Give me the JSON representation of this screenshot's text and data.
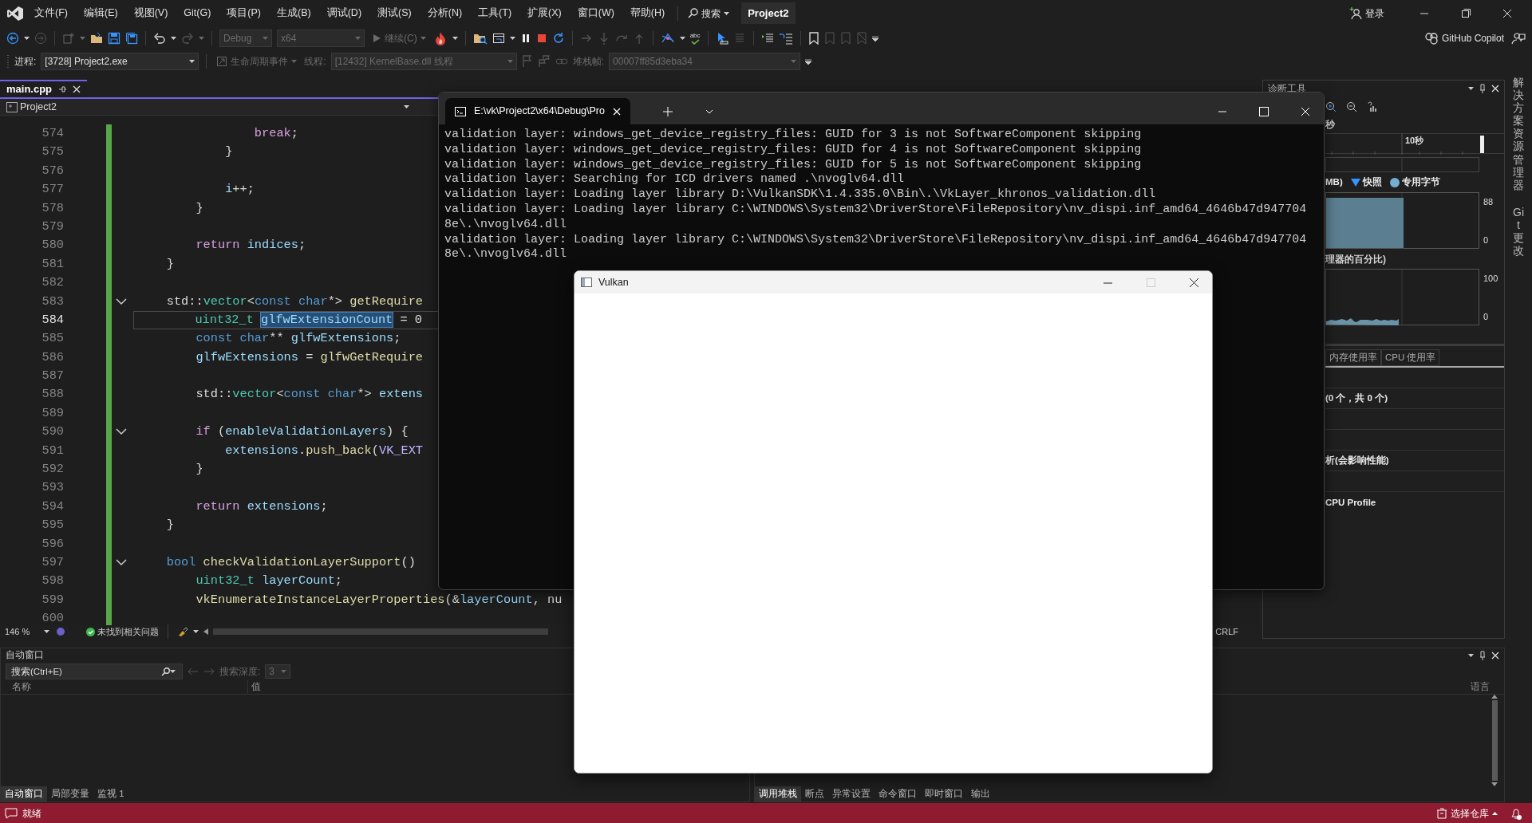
{
  "menu_bar": {
    "menus": [
      "文件(F)",
      "编辑(E)",
      "视图(V)",
      "Git(G)",
      "项目(P)",
      "生成(B)",
      "调试(D)",
      "测试(S)",
      "分析(N)",
      "工具(T)",
      "扩展(X)",
      "窗口(W)",
      "帮助(H)"
    ],
    "search": "搜索",
    "solution": "Project2",
    "sign_in": "登录"
  },
  "toolbar": {
    "config_dropdown": {
      "value": "Debug",
      "disabled": true
    },
    "platform_dropdown": {
      "value": "x64",
      "disabled": true
    },
    "continue_button": {
      "label": "继续(C)",
      "disabled": true
    },
    "spell_check": "abc",
    "copilot": "GitHub Copilot"
  },
  "debug_toolbar": {
    "process_label": "进程:",
    "process_dropdown": {
      "value": "[3728] Project2.exe",
      "disabled": false
    },
    "lifecycle_button": {
      "label": "生命周期事件",
      "disabled": true
    },
    "thread_label": "线程:",
    "thread_dropdown": {
      "value": "[12432] KernelBase.dll 线程",
      "disabled": true
    },
    "stack_label": "堆栈帧:",
    "stack_dropdown": {
      "value": "00007ff85d3eba34",
      "disabled": true
    }
  },
  "editor": {
    "tab": "main.cpp",
    "project": "Project2",
    "lines": [
      {
        "number": "574",
        "current": false,
        "collapsible": false,
        "tokens": [
          {
            "text": "                break",
            "kind": "control"
          },
          {
            "text": ";",
            "kind": "plain"
          }
        ]
      },
      {
        "number": "575",
        "current": false,
        "collapsible": false,
        "tokens": [
          {
            "text": "            }",
            "kind": "plain"
          }
        ]
      },
      {
        "number": "576",
        "current": false,
        "collapsible": false
      },
      {
        "number": "577",
        "current": false,
        "collapsible": false,
        "tokens": [
          {
            "text": "            i",
            "kind": "variable"
          },
          {
            "text": "++;",
            "kind": "plain"
          }
        ]
      },
      {
        "number": "578",
        "current": false,
        "collapsible": false,
        "tokens": [
          {
            "text": "        }",
            "kind": "plain"
          }
        ]
      },
      {
        "number": "579",
        "current": false,
        "collapsible": false
      },
      {
        "number": "580",
        "current": false,
        "collapsible": false,
        "tokens": [
          {
            "text": "        return",
            "kind": "control"
          },
          {
            "text": " indices",
            "kind": "variable"
          },
          {
            "text": ";",
            "kind": "plain"
          }
        ]
      },
      {
        "number": "581",
        "current": false,
        "collapsible": false,
        "tokens": [
          {
            "text": "    }",
            "kind": "plain"
          }
        ]
      },
      {
        "number": "582",
        "current": false,
        "collapsible": false
      },
      {
        "number": "583",
        "current": false,
        "collapsible": true,
        "tokens": [
          {
            "text": "    std::",
            "kind": "plain"
          },
          {
            "text": "vector",
            "kind": "type"
          },
          {
            "text": "<",
            "kind": "plain"
          },
          {
            "text": "const char",
            "kind": "keyword"
          },
          {
            "text": "*> ",
            "kind": "plain"
          },
          {
            "text": "getRequire",
            "kind": "function"
          }
        ]
      },
      {
        "number": "584",
        "current": true,
        "collapsible": false,
        "tokens": [
          {
            "text": "        uint32_t ",
            "kind": "type"
          },
          {
            "text": "glfwExtensionCount",
            "kind": "selected"
          },
          {
            "text": " = 0",
            "kind": "plain"
          }
        ]
      },
      {
        "number": "585",
        "current": false,
        "collapsible": false,
        "tokens": [
          {
            "text": "        const char",
            "kind": "keyword"
          },
          {
            "text": "** ",
            "kind": "plain"
          },
          {
            "text": "glfwExtensions",
            "kind": "variable"
          },
          {
            "text": ";",
            "kind": "plain"
          }
        ]
      },
      {
        "number": "586",
        "current": false,
        "collapsible": false,
        "tokens": [
          {
            "text": "        glfwExtensions",
            "kind": "variable"
          },
          {
            "text": " = ",
            "kind": "plain"
          },
          {
            "text": "glfwGetRequire",
            "kind": "function"
          }
        ]
      },
      {
        "number": "587",
        "current": false,
        "collapsible": false
      },
      {
        "number": "588",
        "current": false,
        "collapsible": false,
        "tokens": [
          {
            "text": "        std::",
            "kind": "plain"
          },
          {
            "text": "vector",
            "kind": "type"
          },
          {
            "text": "<",
            "kind": "plain"
          },
          {
            "text": "const char",
            "kind": "keyword"
          },
          {
            "text": "*> ",
            "kind": "plain"
          },
          {
            "text": "extens",
            "kind": "variable"
          }
        ]
      },
      {
        "number": "589",
        "current": false,
        "collapsible": false
      },
      {
        "number": "590",
        "current": false,
        "collapsible": true,
        "tokens": [
          {
            "text": "        if",
            "kind": "control"
          },
          {
            "text": " (",
            "kind": "plain"
          },
          {
            "text": "enableValidationLayers",
            "kind": "variable"
          },
          {
            "text": ") {",
            "kind": "plain"
          }
        ]
      },
      {
        "number": "591",
        "current": false,
        "collapsible": false,
        "tokens": [
          {
            "text": "            extensions",
            "kind": "variable"
          },
          {
            "text": ".",
            "kind": "plain"
          },
          {
            "text": "push_back",
            "kind": "function"
          },
          {
            "text": "(",
            "kind": "plain"
          },
          {
            "text": "VK_EXT",
            "kind": "macro"
          }
        ]
      },
      {
        "number": "592",
        "current": false,
        "collapsible": false,
        "tokens": [
          {
            "text": "        }",
            "kind": "plain"
          }
        ]
      },
      {
        "number": "593",
        "current": false,
        "collapsible": false
      },
      {
        "number": "594",
        "current": false,
        "collapsible": false,
        "tokens": [
          {
            "text": "        return",
            "kind": "control"
          },
          {
            "text": " extensions",
            "kind": "variable"
          },
          {
            "text": ";",
            "kind": "plain"
          }
        ]
      },
      {
        "number": "595",
        "current": false,
        "collapsible": false,
        "tokens": [
          {
            "text": "    }",
            "kind": "plain"
          }
        ]
      },
      {
        "number": "596",
        "current": false,
        "collapsible": false
      },
      {
        "number": "597",
        "current": false,
        "collapsible": true,
        "tokens": [
          {
            "text": "    bool",
            "kind": "keyword"
          },
          {
            "text": " checkValidationLayerSupport",
            "kind": "function"
          },
          {
            "text": "()",
            "kind": "plain"
          }
        ]
      },
      {
        "number": "598",
        "current": false,
        "collapsible": false,
        "tokens": [
          {
            "text": "        uint32_t",
            "kind": "type"
          },
          {
            "text": " layerCount",
            "kind": "variable"
          },
          {
            "text": ";",
            "kind": "plain"
          }
        ]
      },
      {
        "number": "599",
        "current": false,
        "collapsible": false,
        "tokens": [
          {
            "text": "        vkEnumerateInstanceLayerProperties",
            "kind": "function"
          },
          {
            "text": "(&",
            "kind": "plain"
          },
          {
            "text": "layerCount",
            "kind": "variable"
          },
          {
            "text": ", nu",
            "kind": "plain"
          }
        ]
      },
      {
        "number": "600",
        "current": false,
        "collapsible": false
      }
    ],
    "zoom": "146 %",
    "issues": "未找到相关问题",
    "line_ending": "CRLF"
  },
  "diagnostics": {
    "title": "诊断工具",
    "time_label": "秒",
    "ruler_label": "10秒",
    "memory_label": "MB)",
    "legend": [
      {
        "label": "快照",
        "kind": "triangle",
        "color": "#3794ff"
      },
      {
        "label": "专用字节",
        "kind": "dot",
        "color": "#75aed0"
      }
    ],
    "memory_max": "88",
    "memory_min": "0",
    "cpu_label": "理器的百分比)",
    "cpu_max": "100",
    "cpu_min": "0",
    "tabs": [
      {
        "label": "内存使用率",
        "selected": false
      },
      {
        "label": "CPU 使用率",
        "selected": false
      }
    ],
    "events": "(0 个，共 0 个)",
    "analysis": "析(会影响性能)",
    "profile": "CPU Profile"
  },
  "side_tabs": [
    "解决方案资源管理器",
    "Git 更改"
  ],
  "autos": {
    "title": "自动窗口",
    "search_placeholder": "搜索(Ctrl+E)",
    "depth_label": "搜索深度:",
    "depth_value": "3",
    "columns": [
      "名称",
      "值"
    ],
    "tabs": [
      {
        "label": "自动窗口",
        "selected": true
      },
      {
        "label": "局部变量",
        "selected": false
      },
      {
        "label": "监视 1",
        "selected": false
      }
    ]
  },
  "call_stack": {
    "columns": [
      "语言"
    ],
    "tabs": [
      {
        "label": "调用堆栈",
        "selected": true
      },
      {
        "label": "断点",
        "selected": false
      },
      {
        "label": "异常设置",
        "selected": false
      },
      {
        "label": "命令窗口",
        "selected": false
      },
      {
        "label": "即时窗口",
        "selected": false
      },
      {
        "label": "输出",
        "selected": false
      }
    ]
  },
  "status_bar": {
    "text": "就绪",
    "repo": "选择仓库"
  },
  "console": {
    "title": "E:\\vk\\Project2\\x64\\Debug\\Pro",
    "lines": [
      "validation layer: windows_get_device_registry_files: GUID for 3 is not SoftwareComponent skipping",
      "validation layer: windows_get_device_registry_files: GUID for 4 is not SoftwareComponent skipping",
      "validation layer: windows_get_device_registry_files: GUID for 5 is not SoftwareComponent skipping",
      "validation layer: Searching for ICD drivers named .\\nvoglv64.dll",
      "validation layer: Loading layer library D:\\VulkanSDK\\1.4.335.0\\Bin\\.\\VkLayer_khronos_validation.dll",
      "validation layer: Loading layer library C:\\WINDOWS\\System32\\DriverStore\\FileRepository\\nv_dispi.inf_amd64_4646b47d947704",
      "8e\\.\\nvoglv64.dll",
      "validation layer: Loading layer library C:\\WINDOWS\\System32\\DriverStore\\FileRepository\\nv_dispi.inf_amd64_4646b47d947704",
      "8e\\.\\nvoglv64.dll"
    ]
  },
  "vulkan_window": {
    "title": "Vulkan"
  }
}
